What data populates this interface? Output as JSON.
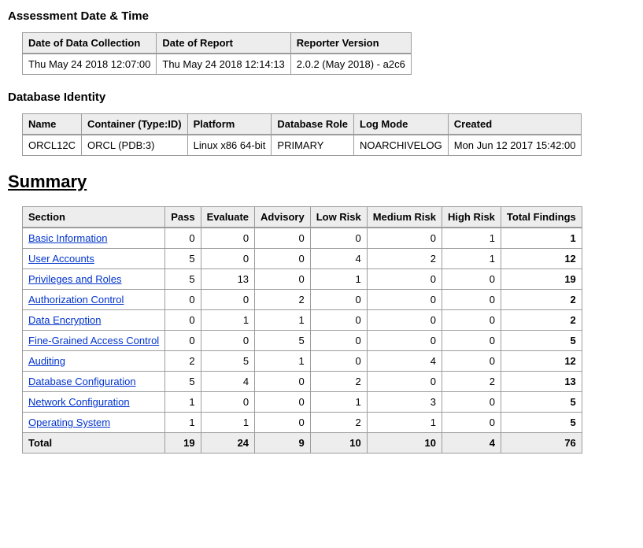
{
  "assessment": {
    "heading": "Assessment Date & Time",
    "headers": [
      "Date of Data Collection",
      "Date of Report",
      "Reporter Version"
    ],
    "row": [
      "Thu May 24 2018 12:07:00",
      "Thu May 24 2018 12:14:13",
      "2.0.2 (May 2018) - a2c6"
    ]
  },
  "identity": {
    "heading": "Database Identity",
    "headers": [
      "Name",
      "Container (Type:ID)",
      "Platform",
      "Database Role",
      "Log Mode",
      "Created"
    ],
    "row": [
      "ORCL12C",
      "ORCL (PDB:3)",
      "Linux x86 64-bit",
      "PRIMARY",
      "NOARCHIVELOG",
      "Mon Jun 12 2017 15:42:00"
    ]
  },
  "summary": {
    "heading": "Summary",
    "headers": [
      "Section",
      "Pass",
      "Evaluate",
      "Advisory",
      "Low Risk",
      "Medium Risk",
      "High Risk",
      "Total Findings"
    ],
    "rows": [
      {
        "section": "Basic Information",
        "pass": 0,
        "evaluate": 0,
        "advisory": 0,
        "low": 0,
        "medium": 0,
        "high": 1,
        "total": 1
      },
      {
        "section": "User Accounts",
        "pass": 5,
        "evaluate": 0,
        "advisory": 0,
        "low": 4,
        "medium": 2,
        "high": 1,
        "total": 12
      },
      {
        "section": "Privileges and Roles",
        "pass": 5,
        "evaluate": 13,
        "advisory": 0,
        "low": 1,
        "medium": 0,
        "high": 0,
        "total": 19
      },
      {
        "section": "Authorization Control",
        "pass": 0,
        "evaluate": 0,
        "advisory": 2,
        "low": 0,
        "medium": 0,
        "high": 0,
        "total": 2
      },
      {
        "section": "Data Encryption",
        "pass": 0,
        "evaluate": 1,
        "advisory": 1,
        "low": 0,
        "medium": 0,
        "high": 0,
        "total": 2
      },
      {
        "section": "Fine-Grained Access Control",
        "pass": 0,
        "evaluate": 0,
        "advisory": 5,
        "low": 0,
        "medium": 0,
        "high": 0,
        "total": 5
      },
      {
        "section": "Auditing",
        "pass": 2,
        "evaluate": 5,
        "advisory": 1,
        "low": 0,
        "medium": 4,
        "high": 0,
        "total": 12
      },
      {
        "section": "Database Configuration",
        "pass": 5,
        "evaluate": 4,
        "advisory": 0,
        "low": 2,
        "medium": 0,
        "high": 2,
        "total": 13
      },
      {
        "section": "Network Configuration",
        "pass": 1,
        "evaluate": 0,
        "advisory": 0,
        "low": 1,
        "medium": 3,
        "high": 0,
        "total": 5
      },
      {
        "section": "Operating System",
        "pass": 1,
        "evaluate": 1,
        "advisory": 0,
        "low": 2,
        "medium": 1,
        "high": 0,
        "total": 5
      }
    ],
    "total_label": "Total",
    "totals": {
      "pass": 19,
      "evaluate": 24,
      "advisory": 9,
      "low": 10,
      "medium": 10,
      "high": 4,
      "total": 76
    }
  }
}
